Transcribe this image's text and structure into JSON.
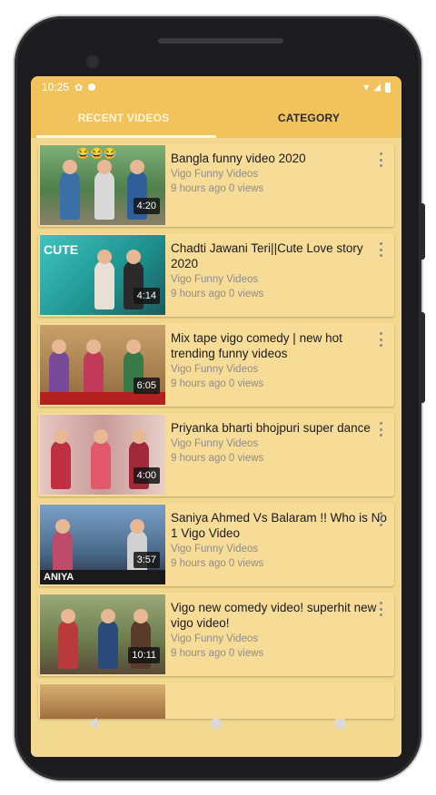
{
  "status_bar": {
    "time": "10:25"
  },
  "tabs": [
    {
      "label": "RECENT VIDEOS",
      "active": true
    },
    {
      "label": "CATEGORY",
      "active": false
    }
  ],
  "videos": [
    {
      "title": "Bangla funny video 2020",
      "channel": "Vigo Funny Videos",
      "meta": "9 hours ago  0 views",
      "duration": "4:20",
      "thumb_text": ""
    },
    {
      "title": "Chadti Jawani Teri||Cute Love story 2020",
      "channel": "Vigo Funny Videos",
      "meta": "9 hours ago  0 views",
      "duration": "4:14",
      "thumb_text": "CUTE"
    },
    {
      "title": "Mix tape vigo comedy | new hot trending funny videos",
      "channel": "Vigo Funny Videos",
      "meta": "9 hours ago  0 views",
      "duration": "6:05",
      "thumb_text": ""
    },
    {
      "title": "Priyanka bharti bhojpuri super dance",
      "channel": "Vigo Funny Videos",
      "meta": "9 hours ago  0 views",
      "duration": "4:00",
      "thumb_text": ""
    },
    {
      "title": "Saniya Ahmed Vs Balaram !! Who is No 1 Vigo Video",
      "channel": "Vigo Funny Videos",
      "meta": "9 hours ago  0 views",
      "duration": "3:57",
      "thumb_text": "ANIYA"
    },
    {
      "title": "Vigo new comedy video! superhit new vigo video!",
      "channel": "Vigo Funny Videos",
      "meta": "9 hours ago  0 views",
      "duration": "10:11",
      "thumb_text": ""
    }
  ],
  "icons": {
    "more": "more-vert-icon",
    "back": "back-icon",
    "home": "home-icon",
    "recents": "recents-icon"
  },
  "colors": {
    "app_bar": "#f2c25c",
    "card": "#f7dc98",
    "screen_bg": "#f3d98f"
  }
}
